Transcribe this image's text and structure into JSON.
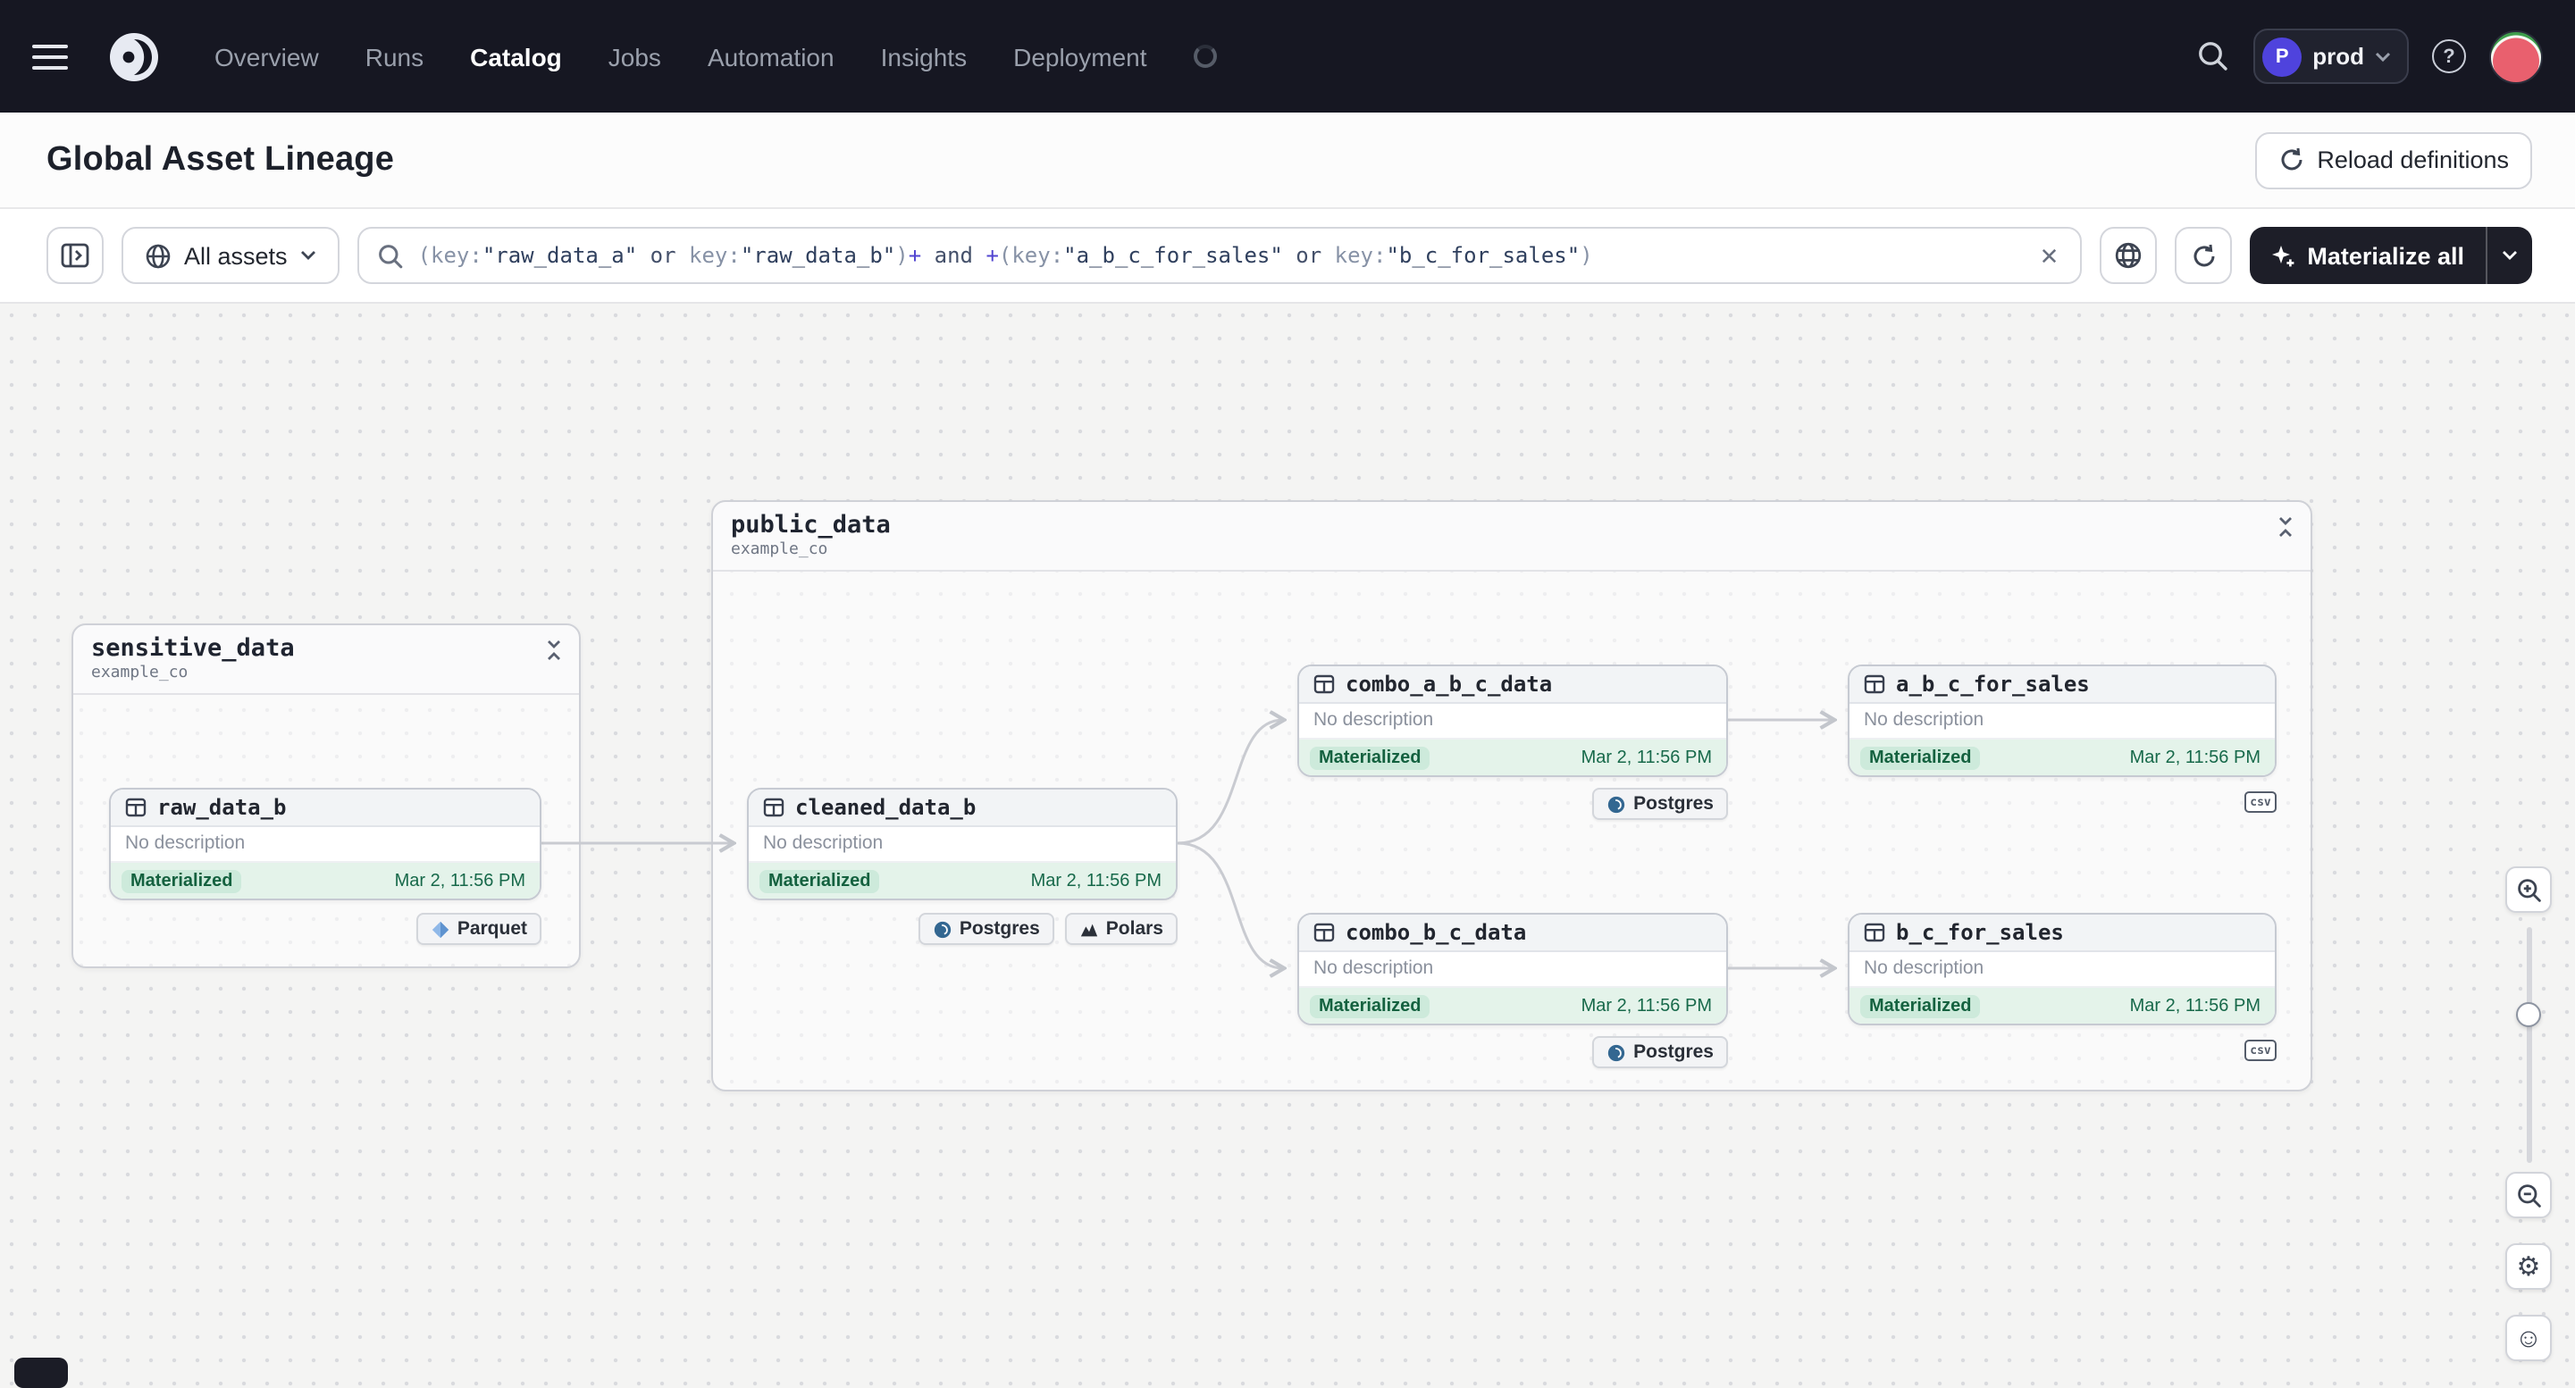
{
  "navbar": {
    "items": [
      "Overview",
      "Runs",
      "Catalog",
      "Jobs",
      "Automation",
      "Insights",
      "Deployment"
    ],
    "active_item": "Catalog",
    "env_badge": {
      "initial": "P",
      "name": "prod"
    }
  },
  "header": {
    "title": "Global Asset Lineage",
    "reload_button": "Reload definitions"
  },
  "toolbar": {
    "scope": "All assets",
    "materialize_button": "Materialize all",
    "clear_icon": "✕",
    "query_segments": [
      {
        "t": "p",
        "x": "(key:"
      },
      {
        "t": "s",
        "x": "\"raw_data_a\""
      },
      {
        "t": "k",
        "x": " or "
      },
      {
        "t": "p",
        "x": "key:"
      },
      {
        "t": "s",
        "x": "\"raw_data_b\""
      },
      {
        "t": "p",
        "x": ")"
      },
      {
        "t": "o",
        "x": "+"
      },
      {
        "t": "k",
        "x": " and "
      },
      {
        "t": "o",
        "x": "+"
      },
      {
        "t": "p",
        "x": "(key:"
      },
      {
        "t": "s",
        "x": "\"a_b_c_for_sales\""
      },
      {
        "t": "k",
        "x": " or "
      },
      {
        "t": "p",
        "x": "key:"
      },
      {
        "t": "s",
        "x": "\"b_c_for_sales\""
      },
      {
        "t": "p",
        "x": ")"
      }
    ]
  },
  "graph": {
    "groups": [
      {
        "name": "sensitive_data",
        "location": "example_co"
      },
      {
        "name": "public_data",
        "location": "example_co"
      }
    ],
    "assets": [
      {
        "name": "raw_data_b",
        "description": "No description",
        "status": "Materialized",
        "timestamp": "Mar 2, 11:56 PM"
      },
      {
        "name": "cleaned_data_b",
        "description": "No description",
        "status": "Materialized",
        "timestamp": "Mar 2, 11:56 PM"
      },
      {
        "name": "combo_a_b_c_data",
        "description": "No description",
        "status": "Materialized",
        "timestamp": "Mar 2, 11:56 PM"
      },
      {
        "name": "a_b_c_for_sales",
        "description": "No description",
        "status": "Materialized",
        "timestamp": "Mar 2, 11:56 PM"
      },
      {
        "name": "combo_b_c_data",
        "description": "No description",
        "status": "Materialized",
        "timestamp": "Mar 2, 11:56 PM"
      },
      {
        "name": "b_c_for_sales",
        "description": "No description",
        "status": "Materialized",
        "timestamp": "Mar 2, 11:56 PM"
      }
    ],
    "kind_tags": {
      "parquet": "Parquet",
      "postgres": "Postgres",
      "polars": "Polars",
      "csv": "csv"
    }
  },
  "floating": {
    "gear_icon": "⚙",
    "face_icon": "☺"
  }
}
